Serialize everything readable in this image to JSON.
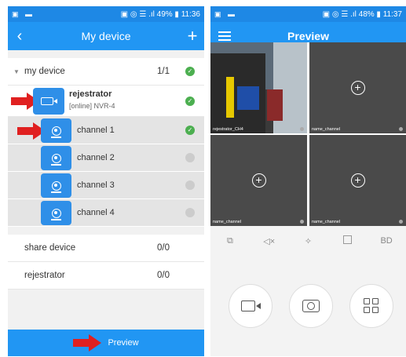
{
  "left": {
    "status": {
      "left": "▣ ▬",
      "right": "▣ ◎ ☰ .ıl 49% ▮ 11:36"
    },
    "nav": {
      "back": "‹",
      "title": "My device",
      "add": "+"
    },
    "group": {
      "label": "my device",
      "count": "1/1"
    },
    "device": {
      "name": "rejestrator",
      "status": "[online] NVR-4"
    },
    "channels": [
      {
        "label": "channel 1",
        "online": true
      },
      {
        "label": "channel 2",
        "online": false
      },
      {
        "label": "channel 3",
        "online": false
      },
      {
        "label": "channel 4",
        "online": false
      }
    ],
    "shared": {
      "label": "share device",
      "count": "0/0"
    },
    "other_group": {
      "label": "rejestrator",
      "count": "0/0"
    },
    "footer": {
      "label": "Preview"
    }
  },
  "right": {
    "status": {
      "left": "▣ ▬",
      "right": "▣ ◎ ☰ .ıl 48% ▮ 11:37"
    },
    "nav": {
      "title": "Preview"
    },
    "cells": [
      {
        "name": "rejestrator_CH4",
        "has_video": true
      },
      {
        "name": "name_channel",
        "has_video": false
      },
      {
        "name": "name_channel",
        "has_video": false
      },
      {
        "name": "name_channel",
        "has_video": false
      }
    ],
    "toolbar": {
      "quality_label": "BD"
    },
    "icons": [
      "split-screen-icon",
      "mute-icon",
      "ptz-icon",
      "fullscreen-icon",
      "record-icon",
      "snapshot-icon",
      "grid-layout-icon"
    ]
  },
  "colors": {
    "accent": "#2196f3",
    "online": "#4caf50",
    "offline": "#cccccc",
    "annotation_arrow": "#e02020"
  }
}
